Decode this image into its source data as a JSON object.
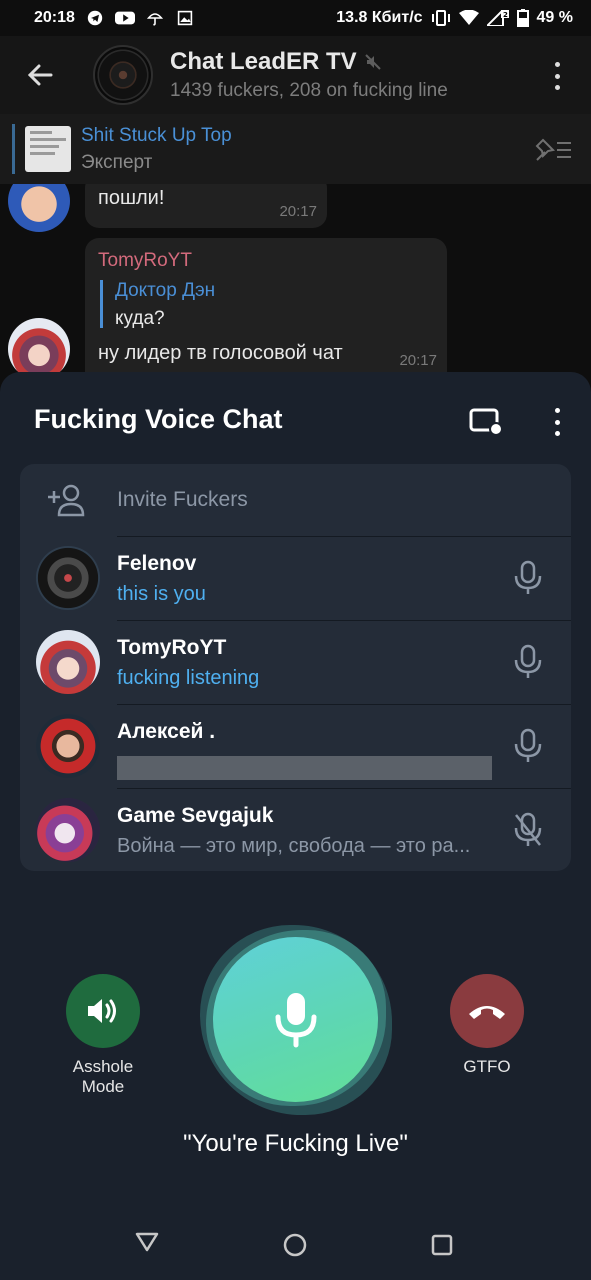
{
  "status_bar": {
    "time": "20:18",
    "network_speed": "13.8 Кбит/с",
    "sim_badge": "2",
    "battery": "49 %"
  },
  "chat_header": {
    "title": "Chat LeadER TV",
    "subtitle": "1439 fuckers, 208 on fucking line",
    "icons": [
      "back-arrow-icon",
      "muted-speaker-icon",
      "more-vertical-icon"
    ]
  },
  "pinned": {
    "title": "Shit Stuck Up Top",
    "subtitle": "Эксперт"
  },
  "messages": [
    {
      "text": "пошли!",
      "time": "20:17"
    },
    {
      "sender": "TomyRoYT",
      "reply_to": "Доктор Дэн",
      "reply_text": "куда?",
      "text": "ну лидер тв голосовой чат",
      "time": "20:17"
    }
  ],
  "voice_chat": {
    "title": "Fucking Voice Chat",
    "invite_label": "Invite Fuckers",
    "participants": [
      {
        "name": "Felenov",
        "status": "this is you",
        "status_color": "#4fb0f0",
        "mic": "mic-icon"
      },
      {
        "name": "TomyRoYT",
        "status": "fucking listening",
        "status_color": "#4fb0f0",
        "mic": "mic-icon"
      },
      {
        "name": "Алексей .",
        "status": "",
        "mic": "mic-icon"
      },
      {
        "name": "Game Sevgajuk",
        "status": "Война — это мир, свобода — это ра...",
        "status_color": "#8c97a6",
        "mic": "mic-muted-icon"
      }
    ],
    "left_button": {
      "label_line1": "Asshole",
      "label_line2": "Mode",
      "color": "#1f6b3e"
    },
    "right_button": {
      "label": "GTFO",
      "color": "#8a3b3f"
    },
    "live_label": "\"You're Fucking Live\"",
    "accent_gradient": [
      "#5fd1d9",
      "#62df98"
    ]
  },
  "nav": [
    "back-triangle-icon",
    "home-circle-icon",
    "recents-square-icon"
  ]
}
